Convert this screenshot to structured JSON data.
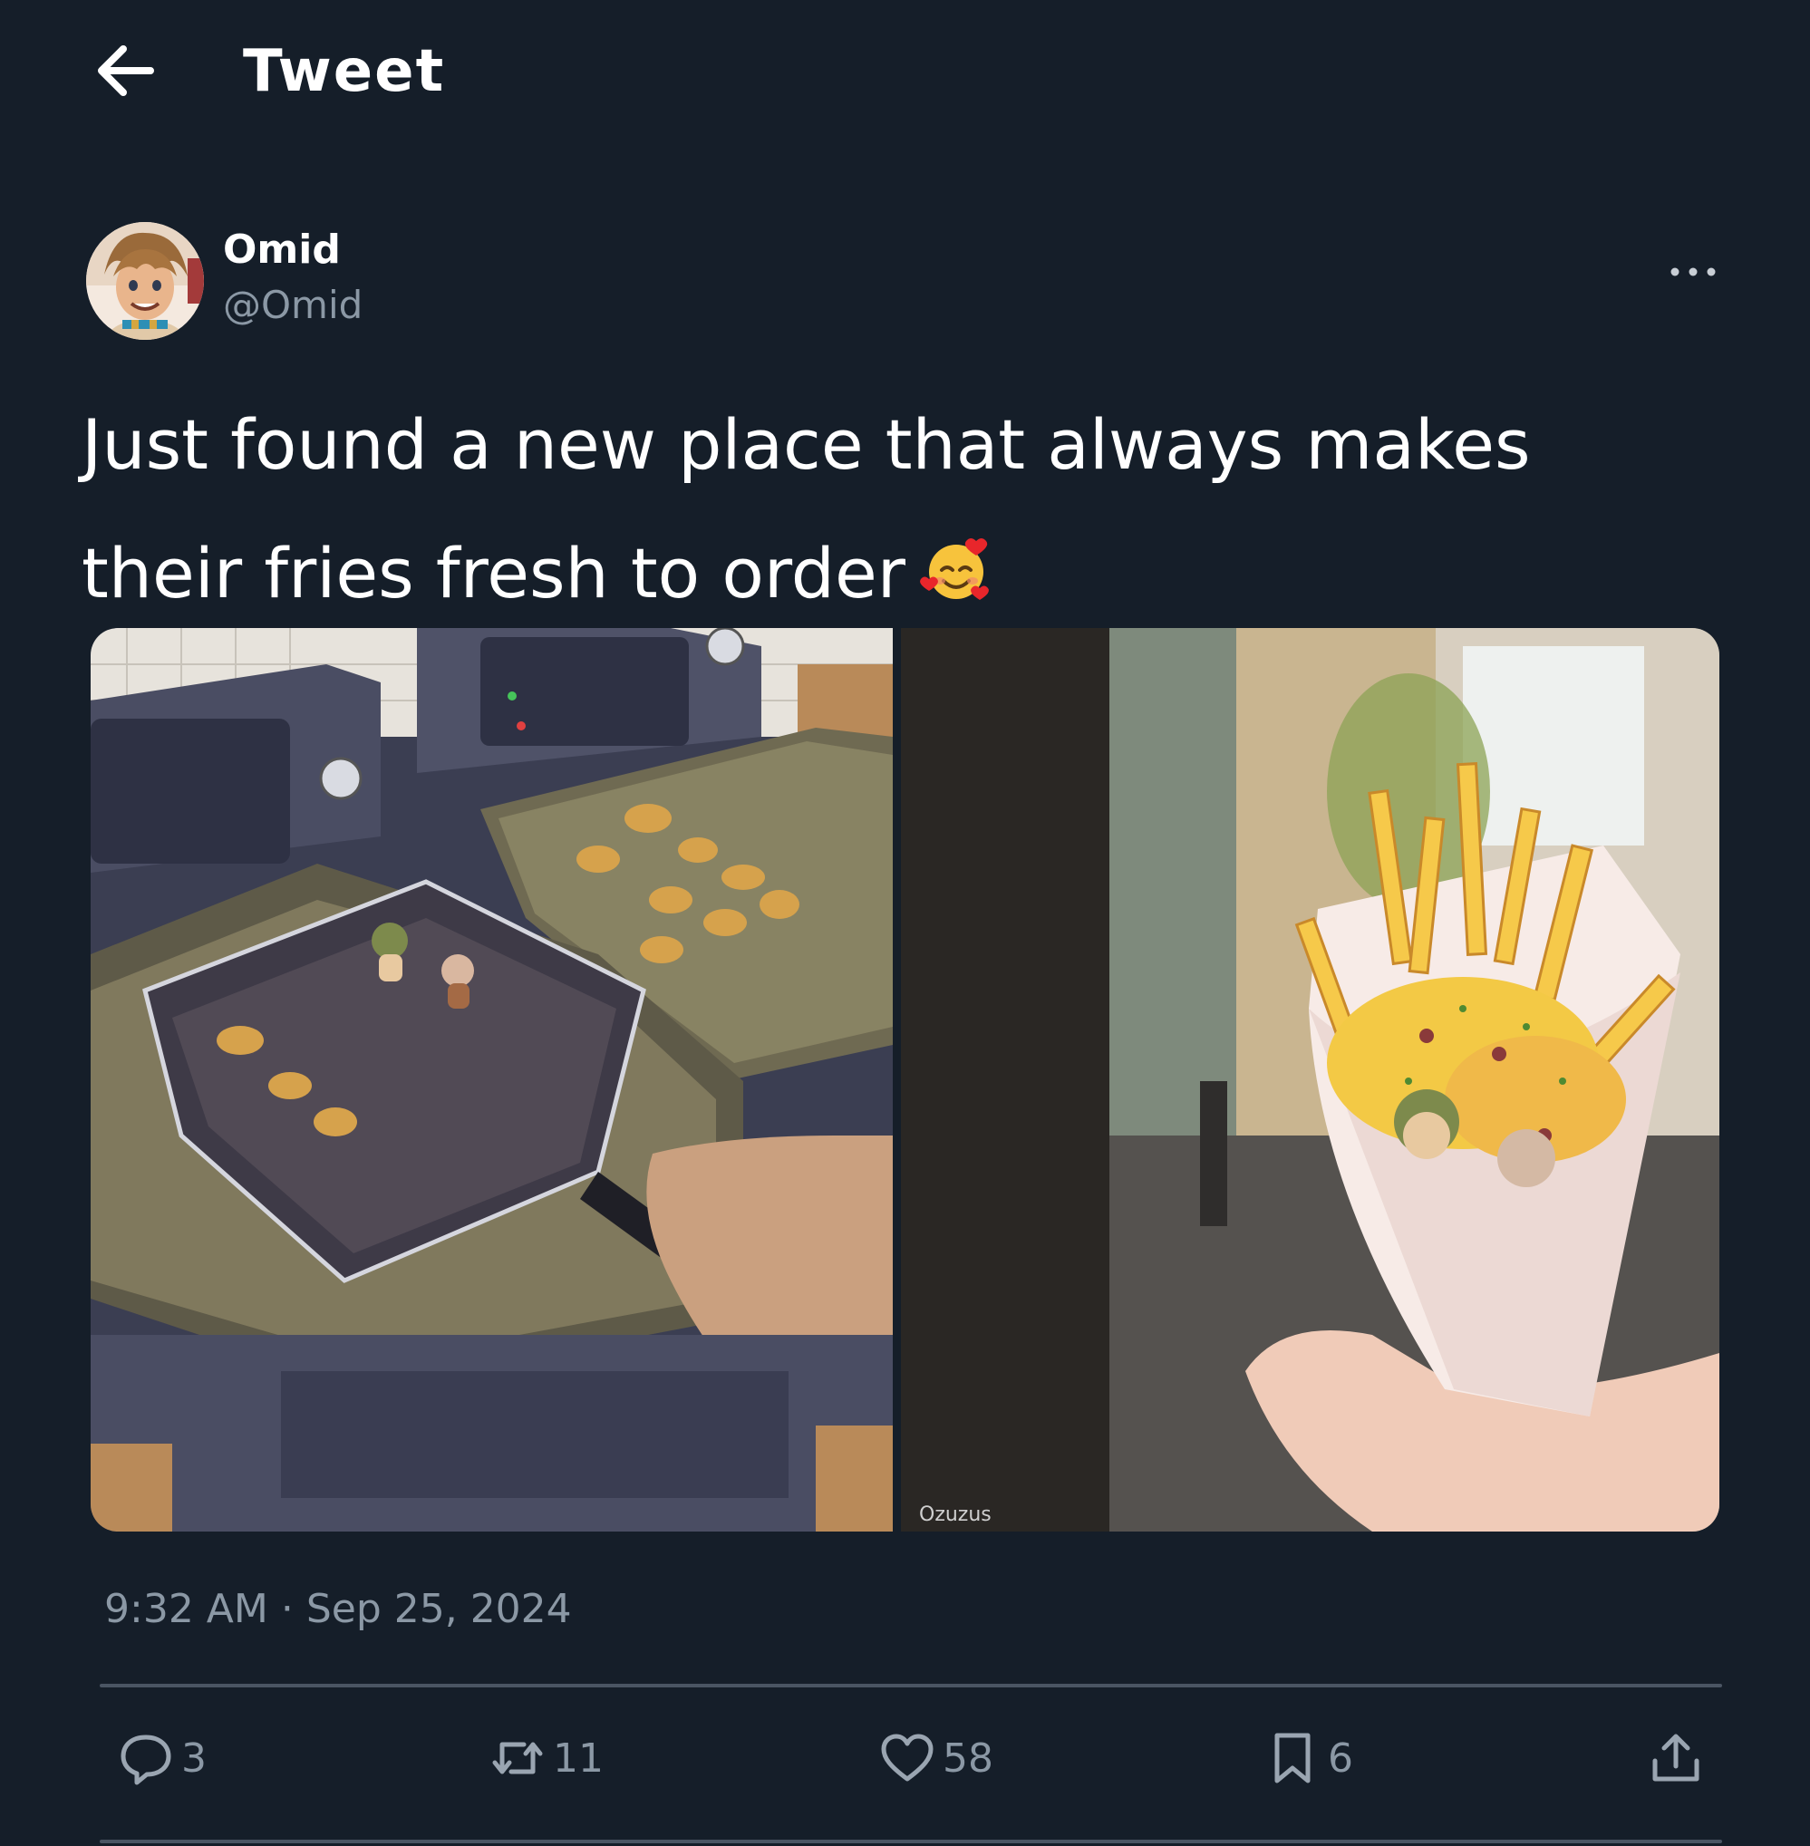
{
  "header": {
    "title": "Tweet"
  },
  "author": {
    "display_name": "Omid",
    "handle": "@Omid"
  },
  "tweet": {
    "text_line1": "Just found a new place that always makes",
    "text_line2": "their fries fresh to order",
    "emoji_name": "smiling-face-with-hearts"
  },
  "media": {
    "image1": "deep fryer with fryer basket, nuggets and two small figures in oil",
    "image2": "paper cone of fries with cheese, nuggets and two small figures",
    "watermark": "Ozuzus"
  },
  "meta": {
    "timestamp": "9:32 AM · Sep 25, 2024"
  },
  "actions": {
    "replies": "3",
    "retweets": "11",
    "likes": "58",
    "bookmarks": "6"
  },
  "colors": {
    "background": "#151e29",
    "text": "#ffffff",
    "muted": "#8b98a5",
    "divider": "#4a5563"
  }
}
